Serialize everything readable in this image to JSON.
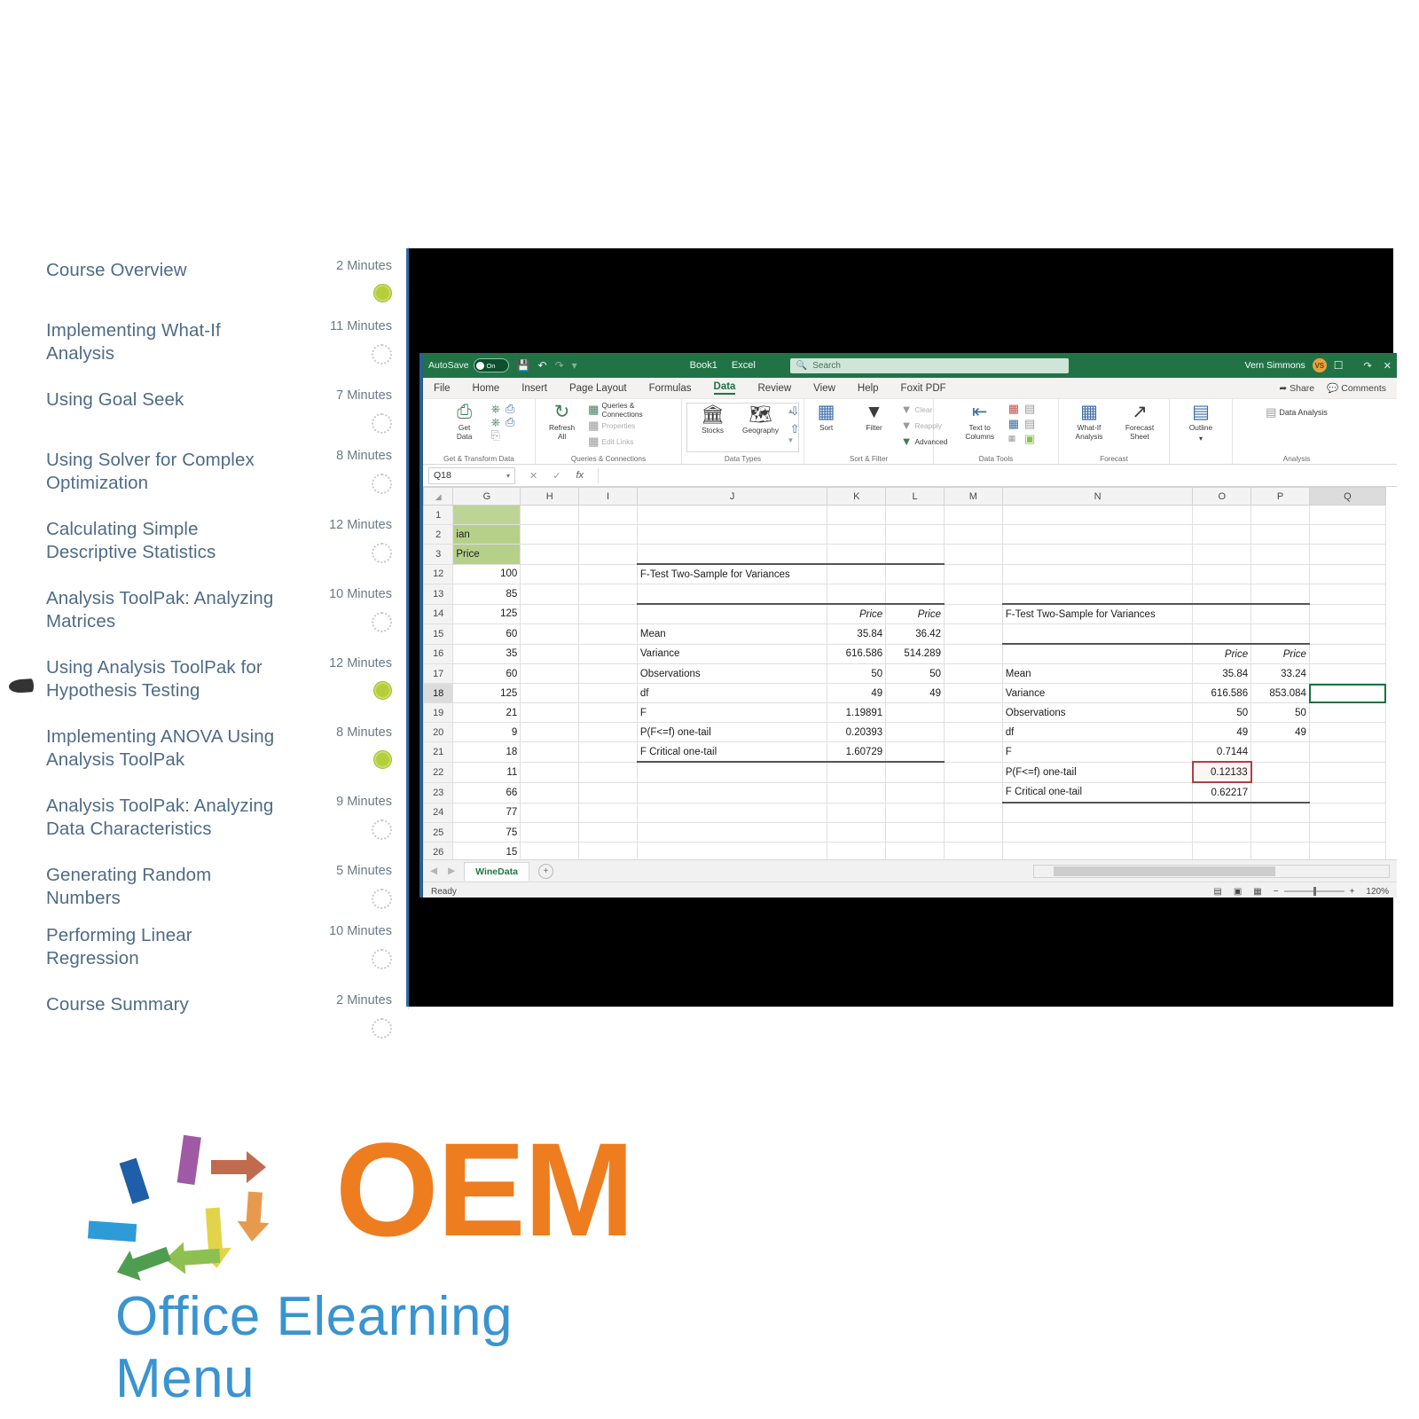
{
  "course": {
    "lessons": [
      {
        "title": "Course Overview",
        "minutes": "2 Minutes",
        "status": "done"
      },
      {
        "title": "Implementing What-If Analysis",
        "minutes": "11 Minutes",
        "status": "todo"
      },
      {
        "title": "Using Goal Seek",
        "minutes": "7 Minutes",
        "status": "todo"
      },
      {
        "title": "Using Solver for Complex Optimization",
        "minutes": "8 Minutes",
        "status": "todo"
      },
      {
        "title": "Calculating Simple Descriptive Statistics",
        "minutes": "12 Minutes",
        "status": "todo"
      },
      {
        "title": "Analysis ToolPak: Analyzing Matrices",
        "minutes": "10 Minutes",
        "status": "todo"
      },
      {
        "title": "Using Analysis ToolPak for Hypothesis Testing",
        "minutes": "12 Minutes",
        "status": "done",
        "current": true
      },
      {
        "title": "Implementing ANOVA Using Analysis ToolPak",
        "minutes": "8 Minutes",
        "status": "done"
      },
      {
        "title": "Analysis ToolPak: Analyzing Data Characteristics",
        "minutes": "9 Minutes",
        "status": "todo"
      },
      {
        "title": "Generating Random Numbers",
        "minutes": "5 Minutes",
        "status": "todo"
      },
      {
        "title": "Performing Linear Regression",
        "minutes": "10 Minutes",
        "status": "todo"
      },
      {
        "title": "Course Summary",
        "minutes": "2 Minutes",
        "status": "todo"
      }
    ]
  },
  "excel": {
    "titlebar": {
      "autosave_label": "AutoSave",
      "autosave_state": "On",
      "save_icon": "save-icon",
      "undo_icon": "undo-icon",
      "redo_icon": "redo-icon",
      "customize_icon": "customize-quick-access-icon",
      "document_name": "Book1",
      "app_name": "Excel",
      "search_placeholder": "Search",
      "search_icon": "search-icon",
      "user_name": "Vern Simmons",
      "user_initials": "VS",
      "presence_icon": "presence-icon",
      "ribbon_display_icon": "ribbon-display-options-icon",
      "close_icon": "close-icon"
    },
    "tabs": [
      {
        "label": "File"
      },
      {
        "label": "Home"
      },
      {
        "label": "Insert"
      },
      {
        "label": "Page Layout"
      },
      {
        "label": "Formulas"
      },
      {
        "label": "Data",
        "active": true
      },
      {
        "label": "Review"
      },
      {
        "label": "View"
      },
      {
        "label": "Help"
      },
      {
        "label": "Foxit PDF"
      }
    ],
    "tabs_right": [
      {
        "label": "Share",
        "icon": "share-icon"
      },
      {
        "label": "Comments",
        "icon": "comments-icon"
      }
    ],
    "ribbon_groups": [
      {
        "name": "Get & Transform Data",
        "label": "Get & Transform Data",
        "big": [
          {
            "label": "Get\nData",
            "icon": "get-data-icon"
          }
        ],
        "small": [
          {
            "label": "",
            "icon": "from-text-csv-icon"
          },
          {
            "label": "",
            "icon": "from-web-icon"
          },
          {
            "label": "",
            "icon": "from-table-range-icon"
          },
          {
            "label": "",
            "icon": "recent-sources-icon"
          },
          {
            "label": "",
            "icon": "existing-connections-icon"
          }
        ]
      },
      {
        "name": "Queries & Connections",
        "label": "Queries & Connections",
        "big": [
          {
            "label": "Refresh\nAll",
            "icon": "refresh-all-icon"
          }
        ],
        "small": [
          {
            "label": "Queries & Connections",
            "icon": "queries-connections-icon"
          },
          {
            "label": "Properties",
            "icon": "properties-icon",
            "disabled": true
          },
          {
            "label": "Edit Links",
            "icon": "edit-links-icon",
            "disabled": true
          }
        ]
      },
      {
        "name": "Data Types",
        "label": "Data Types",
        "big": [
          {
            "label": "Stocks",
            "icon": "stocks-icon"
          },
          {
            "label": "Geography",
            "icon": "geography-icon"
          }
        ],
        "small": []
      },
      {
        "name": "Sort & Filter",
        "label": "Sort & Filter",
        "big": [
          {
            "label": "Sort",
            "icon": "sort-icon"
          },
          {
            "label": "Filter",
            "icon": "filter-icon"
          }
        ],
        "small": [
          {
            "label": "Clear",
            "icon": "clear-filter-icon",
            "disabled": true
          },
          {
            "label": "Reapply",
            "icon": "reapply-icon",
            "disabled": true
          },
          {
            "label": "Advanced",
            "icon": "advanced-filter-icon"
          }
        ]
      },
      {
        "name": "Data Tools",
        "label": "Data Tools",
        "big": [
          {
            "label": "Text to\nColumns",
            "icon": "text-to-columns-icon"
          }
        ],
        "small": [
          {
            "label": "",
            "icon": "flash-fill-icon"
          },
          {
            "label": "",
            "icon": "remove-duplicates-icon"
          },
          {
            "label": "",
            "icon": "data-validation-icon"
          },
          {
            "label": "",
            "icon": "consolidate-icon"
          },
          {
            "label": "",
            "icon": "relationships-icon"
          },
          {
            "label": "",
            "icon": "manage-data-model-icon"
          }
        ]
      },
      {
        "name": "Forecast",
        "label": "Forecast",
        "big": [
          {
            "label": "What-If\nAnalysis",
            "icon": "what-if-analysis-icon"
          },
          {
            "label": "Forecast\nSheet",
            "icon": "forecast-sheet-icon"
          }
        ],
        "small": []
      },
      {
        "name": "Outline",
        "label": "",
        "big": [
          {
            "label": "Outline",
            "icon": "outline-icon"
          }
        ],
        "small": []
      },
      {
        "name": "Analysis",
        "label": "Analysis",
        "big": [],
        "small": [
          {
            "label": "Data Analysis",
            "icon": "data-analysis-icon"
          }
        ]
      }
    ],
    "formula_bar": {
      "name_box": "Q18",
      "cancel_icon": "cancel-icon",
      "enter_icon": "enter-icon",
      "function_icon": "insert-function-icon",
      "formula_value": ""
    },
    "grid": {
      "column_headers": [
        "G",
        "H",
        "I",
        "J",
        "K",
        "L",
        "M",
        "N",
        "O",
        "P",
        "Q"
      ],
      "row_numbers": [
        "1",
        "2",
        "3",
        "12",
        "13",
        "14",
        "15",
        "16",
        "17",
        "18",
        "19",
        "20",
        "21",
        "22",
        "23",
        "24",
        "25",
        "26"
      ],
      "selected_row": "18",
      "selected_column": "Q",
      "green_cells": [
        {
          "row": "1",
          "col": "G",
          "value": ""
        },
        {
          "row": "2",
          "col": "G",
          "value": "ian"
        },
        {
          "row": "3",
          "col": "G",
          "value": "Price"
        }
      ],
      "column_g_values": [
        {
          "row": "12",
          "value": "100"
        },
        {
          "row": "13",
          "value": "85"
        },
        {
          "row": "14",
          "value": "125"
        },
        {
          "row": "15",
          "value": "60"
        },
        {
          "row": "16",
          "value": "35"
        },
        {
          "row": "17",
          "value": "60"
        },
        {
          "row": "18",
          "value": "125"
        },
        {
          "row": "19",
          "value": "21"
        },
        {
          "row": "20",
          "value": "9"
        },
        {
          "row": "21",
          "value": "18"
        },
        {
          "row": "22",
          "value": "11"
        },
        {
          "row": "23",
          "value": "66"
        },
        {
          "row": "24",
          "value": "77"
        },
        {
          "row": "25",
          "value": "75"
        },
        {
          "row": "26",
          "value": "15"
        }
      ]
    },
    "ftest_left": {
      "title": "F-Test Two-Sample for Variances",
      "col_headers": [
        "Price",
        "Price"
      ],
      "rows": [
        {
          "label": "Mean",
          "v1": "35.84",
          "v2": "36.42"
        },
        {
          "label": "Variance",
          "v1": "616.586",
          "v2": "514.289"
        },
        {
          "label": "Observations",
          "v1": "50",
          "v2": "50"
        },
        {
          "label": "df",
          "v1": "49",
          "v2": "49"
        },
        {
          "label": "F",
          "v1": "1.19891",
          "v2": ""
        },
        {
          "label": "P(F<=f) one-tail",
          "v1": "0.20393",
          "v2": ""
        },
        {
          "label": "F Critical one-tail",
          "v1": "1.60729",
          "v2": ""
        }
      ]
    },
    "ftest_right": {
      "title": "F-Test Two-Sample for Variances",
      "col_headers": [
        "Price",
        "Price"
      ],
      "rows": [
        {
          "label": "Mean",
          "v1": "35.84",
          "v2": "33.24"
        },
        {
          "label": "Variance",
          "v1": "616.586",
          "v2": "853.084"
        },
        {
          "label": "Observations",
          "v1": "50",
          "v2": "50"
        },
        {
          "label": "df",
          "v1": "49",
          "v2": "49"
        },
        {
          "label": "F",
          "v1": "0.7144",
          "v2": ""
        },
        {
          "label": "P(F<=f) one-tail",
          "v1": "0.12133",
          "v2": "",
          "highlight": true
        },
        {
          "label": "F Critical one-tail",
          "v1": "0.62217",
          "v2": ""
        }
      ]
    },
    "sheetbar": {
      "prev_icon": "previous-sheet-icon",
      "next_icon": "next-sheet-icon",
      "sheet_name": "WineData",
      "add_sheet_icon": "add-sheet-icon"
    },
    "statusbar": {
      "status_text": "Ready",
      "normal_view_icon": "normal-view-icon",
      "page_layout_icon": "page-layout-view-icon",
      "page_break_icon": "page-break-preview-icon",
      "zoom_out_icon": "zoom-out-icon",
      "zoom_in_icon": "zoom-in-icon",
      "zoom_level": "120%"
    }
  },
  "logo": {
    "wordmark": "OEM",
    "tagline": "Office Elearning Menu",
    "wordmark_color": "#ee7d1f",
    "tagline_color": "#3a94d0",
    "arrow_colors": [
      "#1f5fa9",
      "#2f9bd6",
      "#3ba8d8",
      "#a05aa5",
      "#c06b4e",
      "#e79a4e",
      "#e6b84c",
      "#e2d44a",
      "#8cc152",
      "#4f9e4f"
    ]
  }
}
